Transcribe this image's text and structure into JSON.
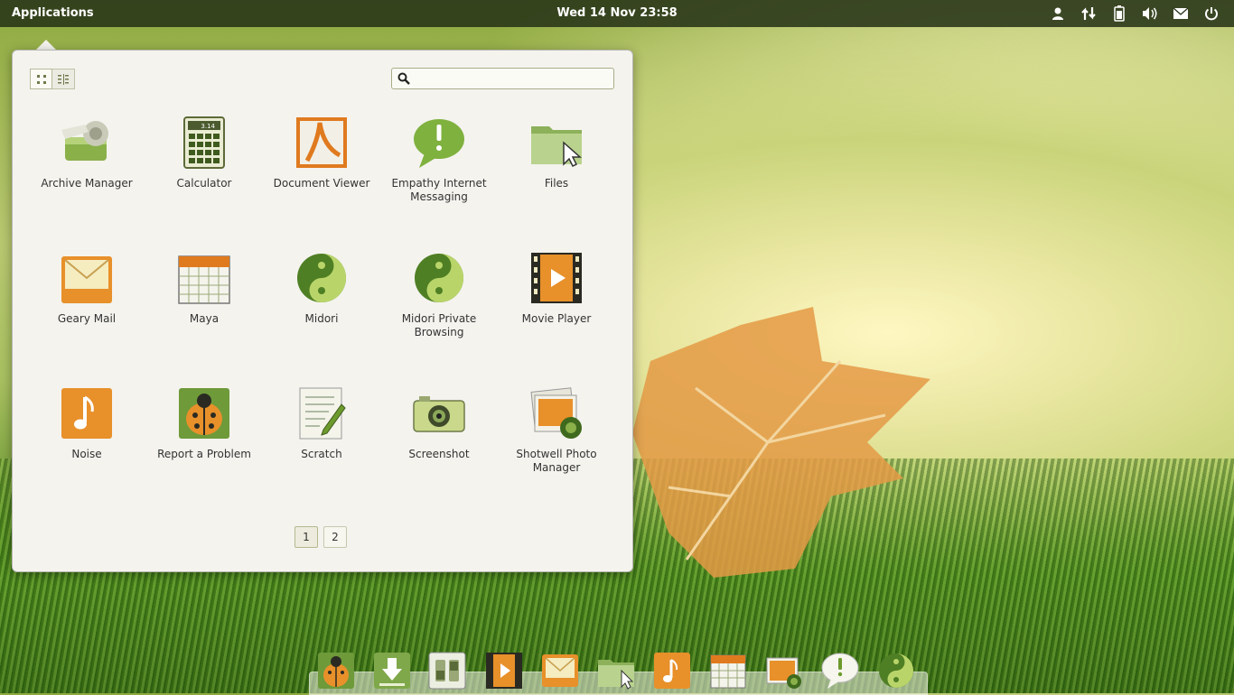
{
  "panel": {
    "applications_label": "Applications",
    "clock": "Wed 14 Nov 23:58",
    "tray": [
      {
        "icon": "user-icon"
      },
      {
        "icon": "network-icon"
      },
      {
        "icon": "battery-icon"
      },
      {
        "icon": "volume-icon"
      },
      {
        "icon": "mail-icon"
      },
      {
        "icon": "power-icon"
      }
    ]
  },
  "launcher": {
    "view_modes": [
      {
        "icon": "grid-view-icon",
        "active": true
      },
      {
        "icon": "category-view-icon",
        "active": false
      }
    ],
    "search": {
      "value": "",
      "placeholder": ""
    },
    "apps": [
      {
        "label": "Archive Manager",
        "icon": "archive-manager-icon"
      },
      {
        "label": "Calculator",
        "icon": "calculator-icon"
      },
      {
        "label": "Document Viewer",
        "icon": "document-viewer-icon"
      },
      {
        "label": "Empathy Internet Messaging",
        "icon": "empathy-icon"
      },
      {
        "label": "Files",
        "icon": "files-icon"
      },
      {
        "label": "Geary Mail",
        "icon": "geary-mail-icon"
      },
      {
        "label": "Maya",
        "icon": "maya-calendar-icon"
      },
      {
        "label": "Midori",
        "icon": "midori-icon"
      },
      {
        "label": "Midori Private Browsing",
        "icon": "midori-private-icon"
      },
      {
        "label": "Movie Player",
        "icon": "movie-player-icon"
      },
      {
        "label": "Noise",
        "icon": "noise-music-icon"
      },
      {
        "label": "Report a Problem",
        "icon": "ladybug-icon"
      },
      {
        "label": "Scratch",
        "icon": "scratch-text-editor-icon"
      },
      {
        "label": "Screenshot",
        "icon": "camera-icon"
      },
      {
        "label": "Shotwell Photo Manager",
        "icon": "shotwell-photo-icon"
      }
    ],
    "pages": [
      {
        "label": "1",
        "active": true
      },
      {
        "label": "2",
        "active": false
      }
    ]
  },
  "dock": {
    "items": [
      {
        "icon": "ladybug-icon"
      },
      {
        "icon": "download-icon"
      },
      {
        "icon": "switchboard-settings-icon"
      },
      {
        "icon": "movie-player-icon"
      },
      {
        "icon": "geary-mail-icon"
      },
      {
        "icon": "files-icon"
      },
      {
        "icon": "noise-music-icon"
      },
      {
        "icon": "maya-calendar-icon"
      },
      {
        "icon": "shotwell-photo-icon"
      },
      {
        "icon": "empathy-icon"
      },
      {
        "icon": "midori-icon"
      }
    ]
  },
  "colors": {
    "panel_bg": "#28341a",
    "popover_bg": "#f4f3ee",
    "accent_orange": "#e07a1f",
    "accent_green": "#6c9a2c"
  }
}
